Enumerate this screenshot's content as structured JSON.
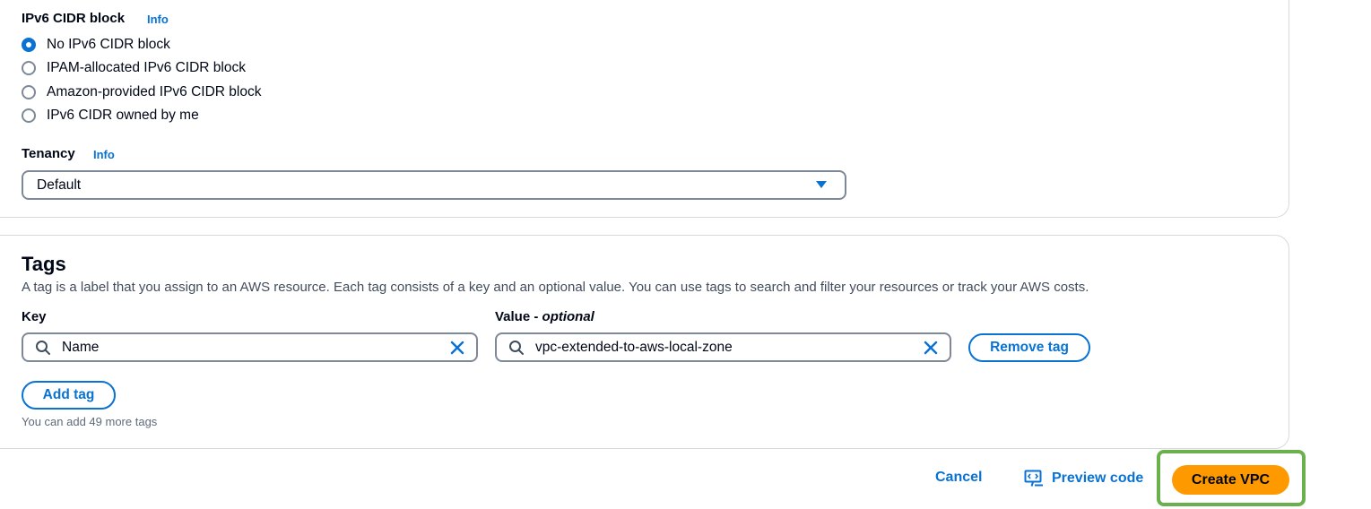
{
  "ipv6": {
    "label": "IPv6 CIDR block",
    "info": "Info",
    "options": [
      {
        "label": "No IPv6 CIDR block",
        "checked": true
      },
      {
        "label": "IPAM-allocated IPv6 CIDR block",
        "checked": false
      },
      {
        "label": "Amazon-provided IPv6 CIDR block",
        "checked": false
      },
      {
        "label": "IPv6 CIDR owned by me",
        "checked": false
      }
    ]
  },
  "tenancy": {
    "label": "Tenancy",
    "info": "Info",
    "value": "Default"
  },
  "tags": {
    "title": "Tags",
    "description": "A tag is a label that you assign to an AWS resource. Each tag consists of a key and an optional value. You can use tags to search and filter your resources or track your AWS costs.",
    "key_label": "Key",
    "value_label": "Value - ",
    "value_optional": "optional",
    "rows": [
      {
        "key": "Name",
        "value": "vpc-extended-to-aws-local-zone",
        "remove_label": "Remove tag"
      }
    ],
    "add_label": "Add tag",
    "hint": "You can add 49 more tags"
  },
  "footer": {
    "cancel": "Cancel",
    "preview": "Preview code",
    "create": "Create VPC"
  },
  "colors": {
    "accent": "#0972d3",
    "primary_button": "#ff9900",
    "highlight": "#6ab04c"
  },
  "icons": {
    "radio": "radio-icon",
    "caret": "caret-down-icon",
    "search": "search-icon",
    "clear": "clear-icon",
    "preview": "preview-code-icon"
  }
}
